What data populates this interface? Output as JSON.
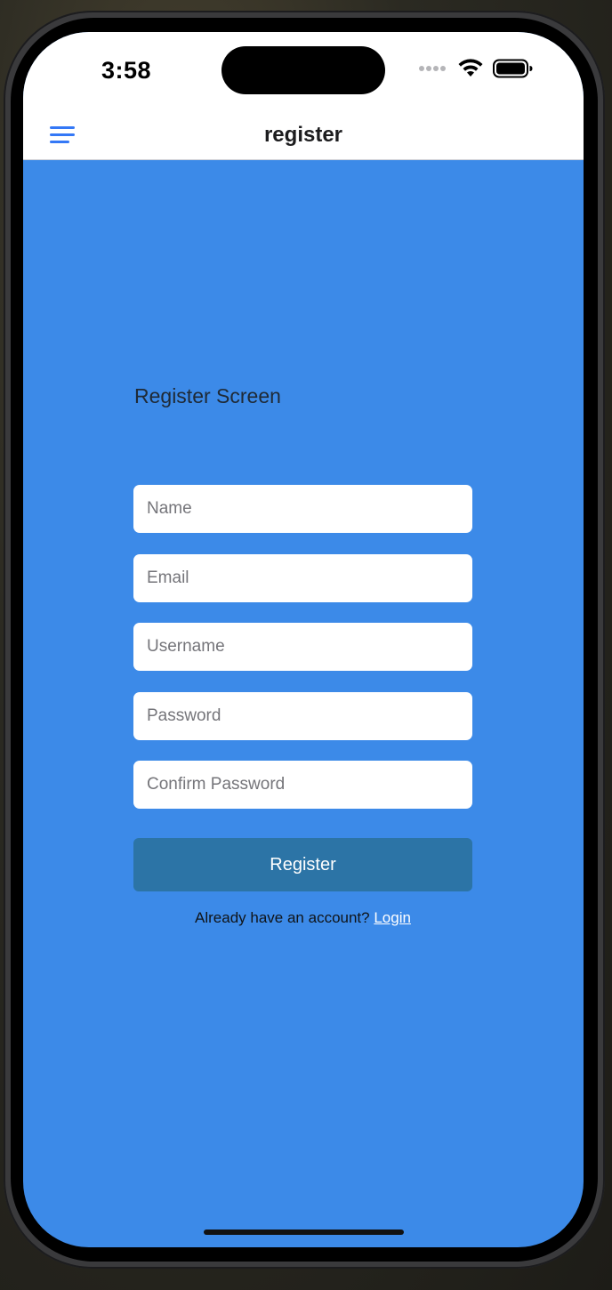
{
  "status_bar": {
    "time": "3:58"
  },
  "nav": {
    "title": "register",
    "menu_icon": "hamburger-menu-icon"
  },
  "form": {
    "heading": "Register Screen",
    "fields": {
      "name": {
        "placeholder": "Name",
        "value": ""
      },
      "email": {
        "placeholder": "Email",
        "value": ""
      },
      "username": {
        "placeholder": "Username",
        "value": ""
      },
      "password": {
        "placeholder": "Password",
        "value": ""
      },
      "confirm_password": {
        "placeholder": "Confirm Password",
        "value": ""
      }
    },
    "submit_label": "Register",
    "login_prompt": "Already have an account? ",
    "login_link": "Login"
  },
  "colors": {
    "background": "#3c8ae8",
    "button": "#2c74a6",
    "accent": "#3478f6",
    "nav_background": "#ffffff"
  }
}
